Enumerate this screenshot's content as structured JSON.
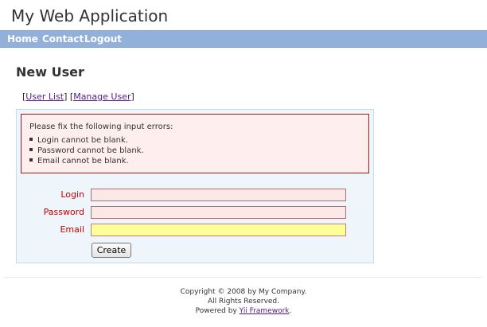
{
  "header": {
    "app_title": "My Web Application"
  },
  "nav": {
    "items": [
      {
        "label": "Home"
      },
      {
        "label": "Contact"
      },
      {
        "label": "Logout"
      }
    ]
  },
  "page": {
    "title": "New User",
    "links": [
      {
        "label": "User List"
      },
      {
        "label": "Manage User"
      }
    ]
  },
  "errors": {
    "heading": "Please fix the following input errors:",
    "items": [
      "Login cannot be blank.",
      "Password cannot be blank.",
      "Email cannot be blank."
    ]
  },
  "form": {
    "login_label": "Login",
    "login_value": "",
    "password_label": "Password",
    "password_value": "",
    "email_label": "Email",
    "email_value": "",
    "submit_label": "Create"
  },
  "footer": {
    "copyright": "Copyright © 2008 by My Company.",
    "rights": "All Rights Reserved.",
    "powered_prefix": "Powered by ",
    "powered_link": "Yii Framework",
    "powered_suffix": "."
  },
  "colors": {
    "nav_background": "#92b0d9",
    "error_border": "#9f1d1d",
    "label_error": "#cc0000",
    "focused_field": "#ffff99"
  }
}
